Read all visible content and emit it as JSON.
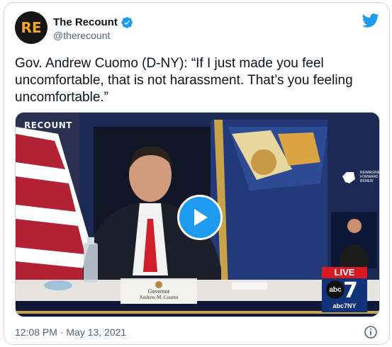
{
  "author": {
    "display_name": "The Recount",
    "handle": "@therecount",
    "avatar_letters": "RE",
    "verified": true
  },
  "tweet": {
    "text": "Gov. Andrew Cuomo (D-NY): “If I just made you feel uncomfortable, that is not harassment. That’s you feeling uncomfortable.”",
    "timestamp": "12:08 PM · May 13, 2021"
  },
  "media": {
    "brand_overlay": "RECOUNT",
    "nameplate_line1": "Governor",
    "nameplate_line2": "Andrew M. Cuomo",
    "live_badge": "LIVE",
    "station_logo": "abc",
    "station_number": "7",
    "station_callsign": "abc7NY",
    "ny_logo_text": "REIMAGINE FORWARD RENEW"
  },
  "colors": {
    "twitter_blue": "#1d9bf0",
    "avatar_accent": "#f5a524",
    "live_red": "#d71920",
    "abc_blue": "#12337a"
  },
  "icons": {
    "brand": "twitter-bird-icon",
    "verified": "verified-badge-icon",
    "play": "play-icon",
    "info": "info-icon"
  }
}
